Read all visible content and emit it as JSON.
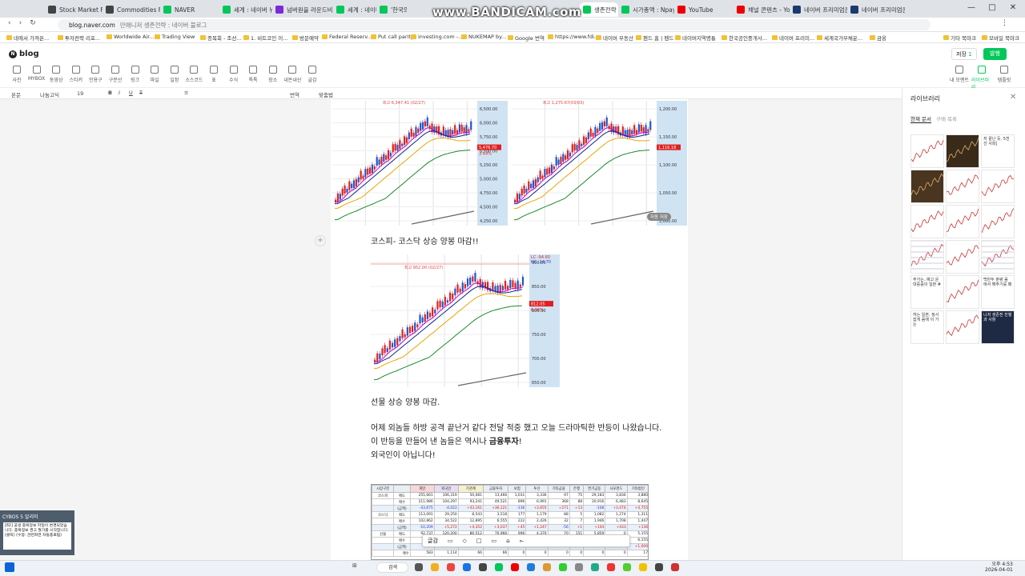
{
  "browser": {
    "tabs": [
      {
        "label": "Stock Market Futur",
        "color": "#444"
      },
      {
        "label": "Commodities Futu",
        "color": "#444"
      },
      {
        "label": "NAVER",
        "color": "#03c75a"
      },
      {
        "label": "세계 : 네이버 뉴스",
        "color": "#03c75a"
      },
      {
        "label": "넘버원을 라운드비",
        "color": "#7b2bd6"
      },
      {
        "label": "세계 : 네이버 뉴스",
        "color": "#03c75a"
      },
      {
        "label": "'한국의 웰쇼",
        "color": "#03c75a"
      },
      {
        "label": "생존전략",
        "color": "#03c75a"
      },
      {
        "label": "시가총액 : Npay 증",
        "color": "#03c75a"
      },
      {
        "label": "YouTube",
        "color": "#e00"
      },
      {
        "label": "채널 콘텐츠 - YouT",
        "color": "#e00"
      },
      {
        "label": "네이버 프리미엄콘",
        "color": "#1a3a6e"
      },
      {
        "label": "네이버 프리미엄콘",
        "color": "#1a3a6e"
      }
    ],
    "url_domain": "blog.naver.com",
    "url_title": "만애니저 생존전략 : 네이버 블로그",
    "watermark": "www.BANDICAM.com",
    "bookmarks": [
      "네에서 가져온...",
      "투자전략 리포...",
      "Worldwide Air...",
      "Trading View",
      "종목회 - 조선...",
      "1. 비트코인 이...",
      "방문예약",
      "Federal Reserv...",
      "Put call parity",
      "investing.com -...",
      "NUKEMAP by...",
      "Google 번역",
      "https://www.fdi...",
      "네이버 부동산",
      "펜드 홈 | 펜드",
      "네이버지역명통",
      "한국공인중개사...",
      "네이버 프리미...",
      "세계국가부채운...",
      "금융",
      "기타 북마크",
      "모바일 북마크"
    ]
  },
  "blog": {
    "logo": "blog",
    "save_label": "저장",
    "save_count": "1",
    "publish_label": "발행",
    "tools": [
      "사진",
      "MYBOX",
      "동영상",
      "스티커",
      "인용구",
      "구분선",
      "링크",
      "파일",
      "일정",
      "소스코드",
      "표",
      "수식",
      "톡톡",
      "장소",
      "내돈내산",
      "글감"
    ],
    "right_tools": [
      "내 모멘트",
      "라이브러리",
      "템플릿"
    ],
    "fmt": {
      "style": "본문",
      "font": "나눔고딕",
      "size": "19",
      "spell": "맞춤법",
      "translate": "번역"
    }
  },
  "post": {
    "caption1": "코스피- 코스닥 상승 양봉 마감!!",
    "caption2": "선물 상승 양봉 마감.",
    "para1": "어제 외놈들 하방 공격 끝난거 같다 전달 적중 했고 오늘 드라마틱한 반등이 나왔습니다.",
    "para2_prefix": "이 반등을 만들어 낸 놈들은 역시나 ",
    "para2_bold": "금융투자",
    "para2_suffix": "!",
    "para3": "외국인이 아닙니다!",
    "kospi_axis": [
      "6,500.00",
      "6,000.00",
      "5,750.00",
      "5,500.00",
      "5,250.00",
      "5,000.00",
      "4,750.00",
      "4,500.00",
      "4,250.00"
    ],
    "kospi_last": "5,476.70",
    "kospi_pct": "3.44%",
    "kospi_high": "최고 6,347.41 (02/27)",
    "kosdaq_axis": [
      "1,200.00",
      "1,150.00",
      "1,100.00",
      "1,050.00",
      "1,000.00"
    ],
    "kosdaq_last": "1,116.18",
    "kosdaq_high": "최고 1,275.67(03/03)",
    "futures_axis": [
      "900.00",
      "850.00",
      "800.00",
      "750.00",
      "700.00",
      "650.00"
    ],
    "futures_high": "최고 952.00 (02/27)",
    "futures_last": "812.05",
    "futures_pct": "6.36%",
    "futures_lc": "LC -94.60",
    "futures_hc": "HC -14.70",
    "auto_save": "자동 저장"
  },
  "investor_table": {
    "headers": [
      "시장구분",
      "",
      "개인",
      "외국인",
      "기관계",
      "금융투자",
      "보험",
      "투신",
      "기타금융",
      "은행",
      "연기금등",
      "사모펀드",
      "기타법인"
    ],
    "rows": [
      [
        "코스피",
        "매도",
        "255,661",
        "106,319",
        "50,081",
        "13,466",
        "1,031",
        "3,336",
        "97",
        "75",
        "29,183",
        "3,836",
        "3,880"
      ],
      [
        "",
        "매수",
        "211,986",
        "104,297",
        "93,241",
        "49,521",
        "896",
        "6,991",
        "368",
        "88",
        "20,916",
        "6,483",
        "8,645"
      ],
      [
        "",
        "(금액)",
        "-43,675",
        "-4,022",
        "+43,161",
        "+36,121",
        "-136",
        "+3,655",
        "+271",
        "+13",
        "-108",
        "+3,474",
        "+4,755"
      ],
      [
        "코스닥",
        "매도",
        "113,091",
        "29,250",
        "8,543",
        "3,518",
        "177",
        "1,179",
        "88",
        "5",
        "1,082",
        "1,274",
        "1,311"
      ],
      [
        "",
        "매수",
        "102,862",
        "34,522",
        "12,895",
        "6,555",
        "222",
        "2,426",
        "32",
        "7",
        "1,946",
        "1,708",
        "1,447"
      ],
      [
        "",
        "(금액)",
        "-10,209",
        "+5,272",
        "+4,352",
        "+3,037",
        "+45",
        "+1,247",
        "-56",
        "+1",
        "+144",
        "+433",
        "+136"
      ],
      [
        "선물",
        "매도",
        "92,737",
        "120,200",
        "86,512",
        "70,966",
        "996",
        "4,370",
        "70",
        "151",
        "5,859",
        "0",
        "5,155"
      ],
      [
        "",
        "매수",
        "",
        "",
        "",
        "",
        "",
        "",
        "",
        "",
        "",
        "0",
        "6,155"
      ],
      [
        "",
        "(금액)",
        "",
        "",
        "",
        "",
        "",
        "",
        "",
        "",
        "",
        "0",
        "+1,000"
      ]
    ],
    "last_row": [
      "",
      "매수",
      "583",
      "1,114",
      "66",
      "66",
      "0",
      "0",
      "0",
      "0",
      "0",
      "0",
      "17"
    ]
  },
  "float_toolbar": {
    "label": "글감"
  },
  "library": {
    "title": "라이브러리",
    "tabs": [
      "현재 문서",
      "구매 목록"
    ],
    "texts": [
      "저 끝난 듯. 5천선 사회]",
      "주가는..예고 운 대중증의 일본 #",
      "백만두 분량 음 에서 해주기를 패",
      "하는 일본, 정사 잡게 음에 이 가는",
      "니저 생존전 진행과 사항"
    ]
  },
  "cybos": {
    "title": "CYBOS 5 알리미",
    "text": "[82] 공생 종목정보 파일이 변경되었습니다. 종목정보 경고 월가를 시작합니다.(클릭) (수정: 관련화면 자동종료됨)"
  },
  "taskbar": {
    "search": "검색",
    "time": "오후 4:53",
    "date": "2026-04-01"
  },
  "colors": {
    "naver_green": "#03c75a",
    "accent": "#ff3b3b"
  },
  "chart_data": [
    {
      "type": "line",
      "title": "",
      "ylim": [
        4250,
        6500
      ],
      "x": [],
      "series": []
    },
    {
      "type": "line",
      "title": "",
      "ylim": [
        1000,
        1200
      ],
      "x": [],
      "series": []
    },
    {
      "type": "line",
      "title": "",
      "ylim": [
        650,
        900
      ],
      "x": [],
      "series": []
    }
  ]
}
